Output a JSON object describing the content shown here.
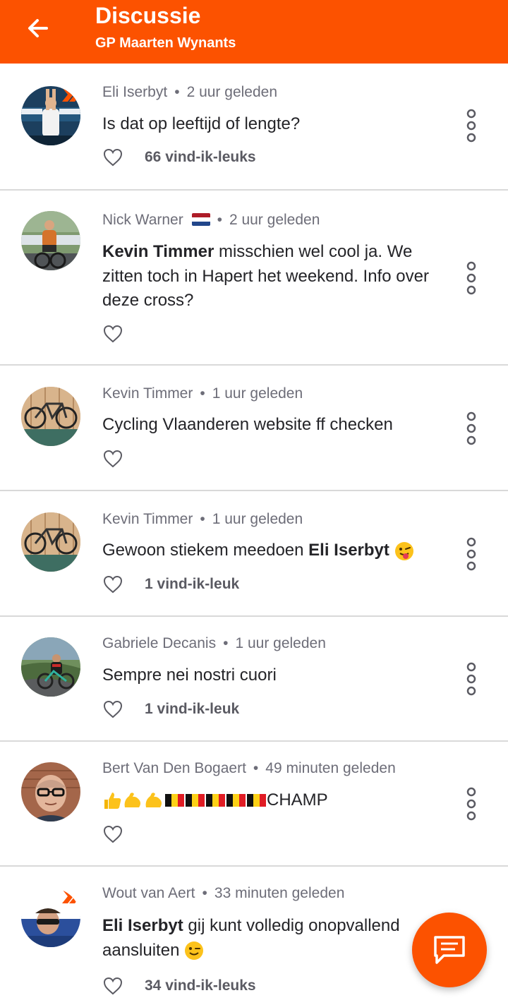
{
  "header": {
    "title": "Discussie",
    "subtitle": "GP Maarten Wynants"
  },
  "comments": [
    {
      "author": "Eli Iserbyt",
      "time": "2 uur geleden",
      "text": "Is dat op leeftijd of lengte?",
      "likes": "66 vind-ik-leuks"
    },
    {
      "author": "Nick Warner",
      "time": "2 uur geleden",
      "mention": "Kevin Timmer",
      "text": " misschien wel cool ja. We zitten toch in Hapert het weekend. Info over deze cross?",
      "likes": ""
    },
    {
      "author": "Kevin Timmer",
      "time": "1 uur geleden",
      "text": "Cycling Vlaanderen website ff checken",
      "likes": ""
    },
    {
      "author": "Kevin Timmer",
      "time": "1 uur geleden",
      "text": "Gewoon stiekem meedoen ",
      "mention": "Eli Iserbyt",
      "likes": "1 vind-ik-leuk"
    },
    {
      "author": "Gabriele Decanis",
      "time": "1 uur geleden",
      "text": "Sempre nei nostri cuori",
      "likes": "1 vind-ik-leuk"
    },
    {
      "author": "Bert Van Den Bogaert",
      "time": "49 minuten geleden",
      "text": "CHAMP",
      "likes": ""
    },
    {
      "author": "Wout van Aert",
      "time": "33 minuten geleden",
      "mention": "Eli Iserbyt",
      "text": " gij kunt volledig onopvallend aansluiten",
      "likes": "34 vind-ik-leuks"
    }
  ],
  "colors": {
    "brand": "#fc5200",
    "divider": "#d9d9d9",
    "meta": "#6d6d78"
  },
  "icons": {
    "back": "arrow-left-icon",
    "like": "heart-outline-icon",
    "more": "more-vertical-icon",
    "compose": "chat-bubble-icon"
  }
}
